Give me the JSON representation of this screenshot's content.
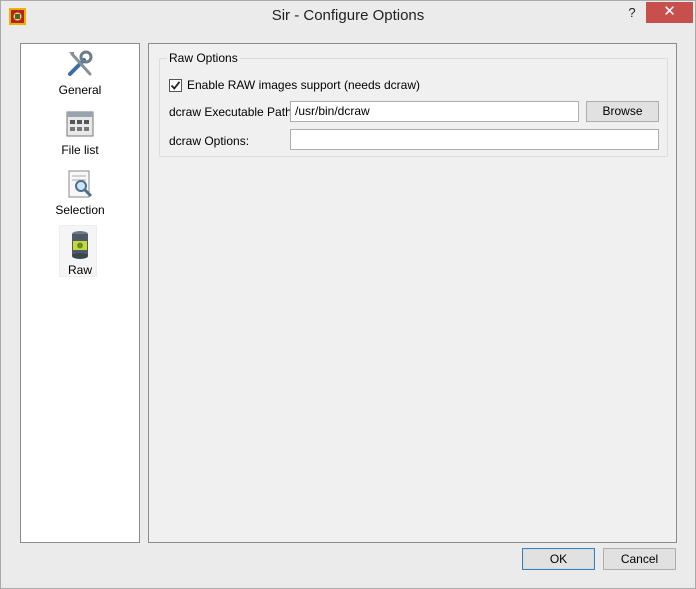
{
  "window": {
    "title": "Sir - Configure Options",
    "help_label": "?",
    "close_label": "✕"
  },
  "sidebar": {
    "items": [
      {
        "label": "General",
        "icon": "tools-icon"
      },
      {
        "label": "File list",
        "icon": "file-list-icon"
      },
      {
        "label": "Selection",
        "icon": "selection-icon"
      },
      {
        "label": "Raw",
        "icon": "raw-icon",
        "selected": true
      }
    ]
  },
  "raw_options": {
    "group_title": "Raw Options",
    "enable_label": "Enable RAW images support (needs dcraw)",
    "enable_checked": true,
    "path_label": "dcraw Executable Path:",
    "path_value": "/usr/bin/dcraw",
    "browse_label": "Browse",
    "options_label": "dcraw Options:",
    "options_value": ""
  },
  "buttons": {
    "ok_label": "OK",
    "cancel_label": "Cancel"
  },
  "colors": {
    "close_button": "#c7504c",
    "window_bg": "#ebebeb"
  }
}
